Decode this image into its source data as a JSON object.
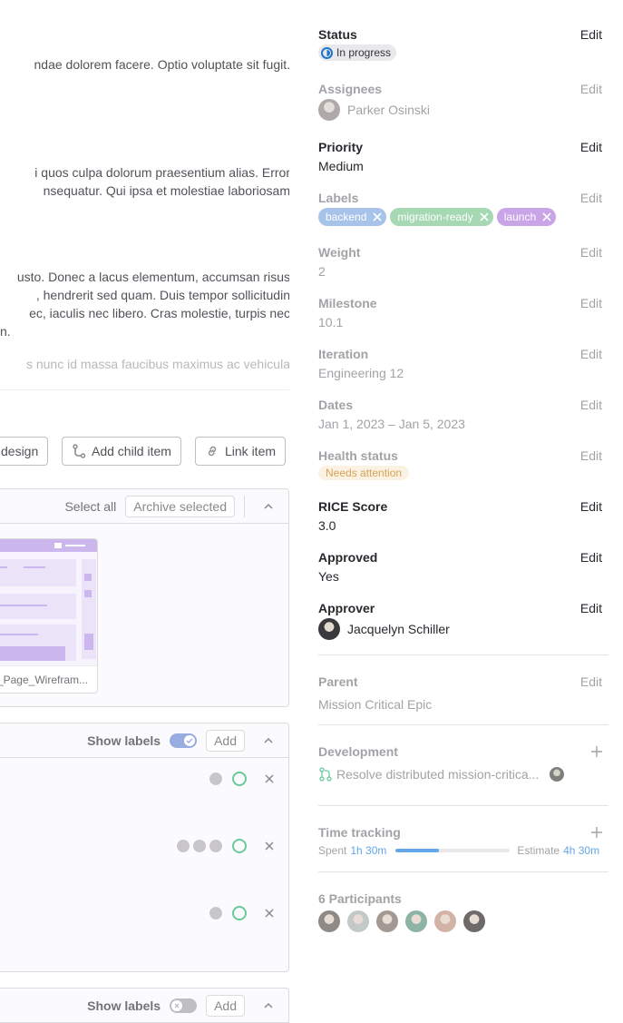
{
  "description": {
    "paragraph1": [
      "ndae dolorem facere. Optio voluptate sit fugit."
    ],
    "paragraph2": [
      "i quos culpa dolorum praesentium alias. Error",
      "nsequatur. Qui ipsa et molestiae laboriosam"
    ],
    "paragraph3": [
      "usto. Donec a lacus elementum, accumsan risus",
      ", hendrerit sed quam. Duis tempor sollicitudin",
      "ec, iaculis nec libero. Cras molestie, turpis nec",
      "n."
    ],
    "paragraph4_faded": "s nunc id massa faucibus maximus ac vehicula"
  },
  "actions": {
    "design_label": "design",
    "add_child_label": "Add child item",
    "link_item_label": "Link item"
  },
  "designs": {
    "select_all": "Select all",
    "archive_selected": "Archive selected",
    "file_name": "g_Page_Wirefram..."
  },
  "tasks": {
    "show_labels": "Show labels",
    "add": "Add",
    "rows": [
      {
        "assignees": 1
      },
      {
        "assignees": 3
      },
      {
        "assignees": 1
      }
    ]
  },
  "tasks2": {
    "show_labels": "Show labels",
    "add": "Add"
  },
  "sidebar": {
    "edit": "Edit",
    "status": {
      "title": "Status",
      "value": "In progress"
    },
    "assignees": {
      "title": "Assignees",
      "name": "Parker Osinski"
    },
    "priority": {
      "title": "Priority",
      "value": "Medium"
    },
    "labels": {
      "title": "Labels",
      "items": [
        {
          "text": "backend",
          "color": "#a8c3ea"
        },
        {
          "text": "migration-ready",
          "color": "#a5d8b3"
        },
        {
          "text": "launch",
          "color": "#c9a4e7"
        }
      ]
    },
    "weight": {
      "title": "Weight",
      "value": "2"
    },
    "milestone": {
      "title": "Milestone",
      "value": "10.1"
    },
    "iteration": {
      "title": "Iteration",
      "value": "Engineering 12"
    },
    "dates": {
      "title": "Dates",
      "value": "Jan 1, 2023 – Jan 5, 2023"
    },
    "health": {
      "title": "Health status",
      "value": "Needs attention"
    },
    "rice": {
      "title": "RICE Score",
      "value": "3.0"
    },
    "approved": {
      "title": "Approved",
      "value": "Yes"
    },
    "approver": {
      "title": "Approver",
      "name": "Jacquelyn Schiller"
    },
    "parent": {
      "title": "Parent",
      "value": "Mission Critical Epic"
    },
    "development": {
      "title": "Development",
      "mr_title": "Resolve distributed mission-critica..."
    },
    "time_tracking": {
      "title": "Time tracking",
      "spent_label": "Spent",
      "spent": "1h 30m",
      "estimate_label": "Estimate",
      "estimate": "4h 30m",
      "progress": 0.38
    },
    "participants": {
      "title": "6 Participants",
      "count": 6
    }
  },
  "colors": {
    "accent_blue": "#1f75cb",
    "progress_blue": "#63a6e9",
    "task_ring_green": "#6ac99a"
  }
}
